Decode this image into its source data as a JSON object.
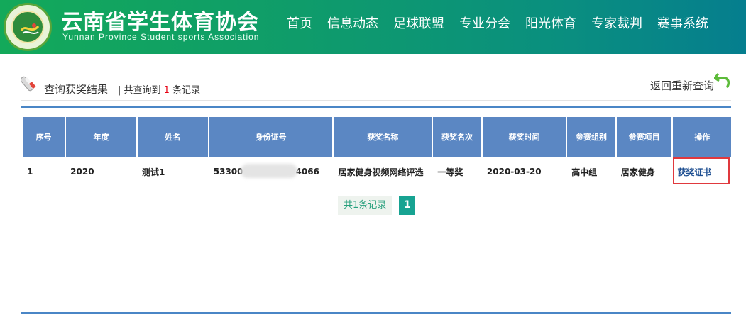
{
  "header": {
    "title": "云南省学生体育协会",
    "subtitle": "Yunnan Province Student sports Association",
    "nav": [
      "首页",
      "信息动态",
      "足球联盟",
      "专业分会",
      "阳光体育",
      "专家裁判",
      "赛事系统"
    ]
  },
  "result": {
    "title": "查询获奖结果",
    "count_prefix": "| 共查询到",
    "count": "1",
    "count_suffix": "条记录",
    "back_label": "返回重新查询"
  },
  "table": {
    "headers": [
      "序号",
      "年度",
      "姓名",
      "身份证号",
      "获奖名称",
      "获奖名次",
      "获奖时间",
      "参赛组别",
      "参赛项目",
      "操作"
    ],
    "rows": [
      {
        "index": "1",
        "year": "2020",
        "name": "测试1",
        "id_start": "53300",
        "id_end": "4066",
        "award_name": "居家健身视频网络评选",
        "rank": "一等奖",
        "date": "2020-03-20",
        "group": "高中组",
        "event": "居家健身",
        "action": "获奖证书"
      }
    ]
  },
  "pager": {
    "total": "共1条记录",
    "current_page": "1"
  },
  "colors": {
    "header_green": "#13a95a",
    "table_header": "#5b87c3",
    "accent_red": "#e60012",
    "pager_teal": "#17a392",
    "link_blue": "#1e4f91"
  },
  "icons": [
    "logo-emblem",
    "scroll-icon",
    "return-arrow-icon"
  ]
}
